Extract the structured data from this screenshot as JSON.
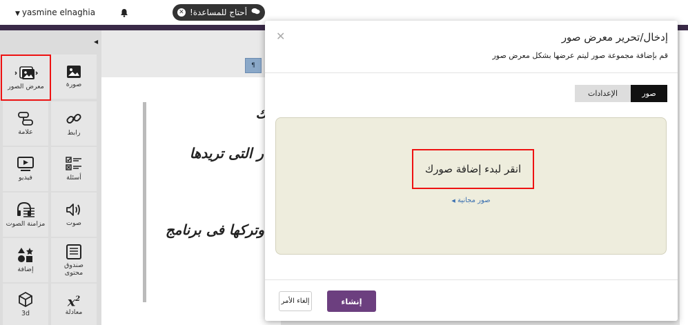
{
  "header": {
    "user_name": "yasmine elnaghia",
    "help_label": "أحتاج للمساعدة!"
  },
  "sidebar": {
    "tiles": [
      {
        "label": "صورة",
        "icon": "image-icon"
      },
      {
        "label": "معرض الصور",
        "icon": "gallery-icon"
      },
      {
        "label": "رابط",
        "icon": "link-icon"
      },
      {
        "label": "علامة",
        "icon": "marker-icon"
      },
      {
        "label": "أسئلة",
        "icon": "questions-icon"
      },
      {
        "label": "فيديو",
        "icon": "video-icon"
      },
      {
        "label": "صوت",
        "icon": "sound-icon"
      },
      {
        "label": "مزامنة الصوت",
        "icon": "audio-sync-icon"
      },
      {
        "label": "صندوق محتوى",
        "icon": "content-box-icon"
      },
      {
        "label": "إضافة",
        "icon": "addon-shapes-icon"
      },
      {
        "label": "معادلة",
        "icon": "equation-icon"
      },
      {
        "label": "3d",
        "icon": "cube-icon"
      }
    ]
  },
  "editor": {
    "lines": [
      "ك",
      "ر التى تريدها",
      "وتركها فى برنامج"
    ]
  },
  "modal": {
    "title": "إدخال/تحرير معرض صور",
    "subtitle": "قم بإضافة مجموعة صور ليتم عرضها بشكل معرض صور",
    "tabs": [
      {
        "label": "صور",
        "active": true
      },
      {
        "label": "الإعدادات",
        "active": false
      }
    ],
    "dropzone_cta": "انقر لبدء إضافة صورك",
    "free_images_link": "صور مجانية",
    "cancel_label": "إلغاء الأمر",
    "create_label": "إنشاء"
  },
  "colors": {
    "accent": "#6c3f7f",
    "header_strip": "#3a2a48",
    "dropzone_bg": "#eeeddd",
    "highlight": "#ee1111"
  }
}
